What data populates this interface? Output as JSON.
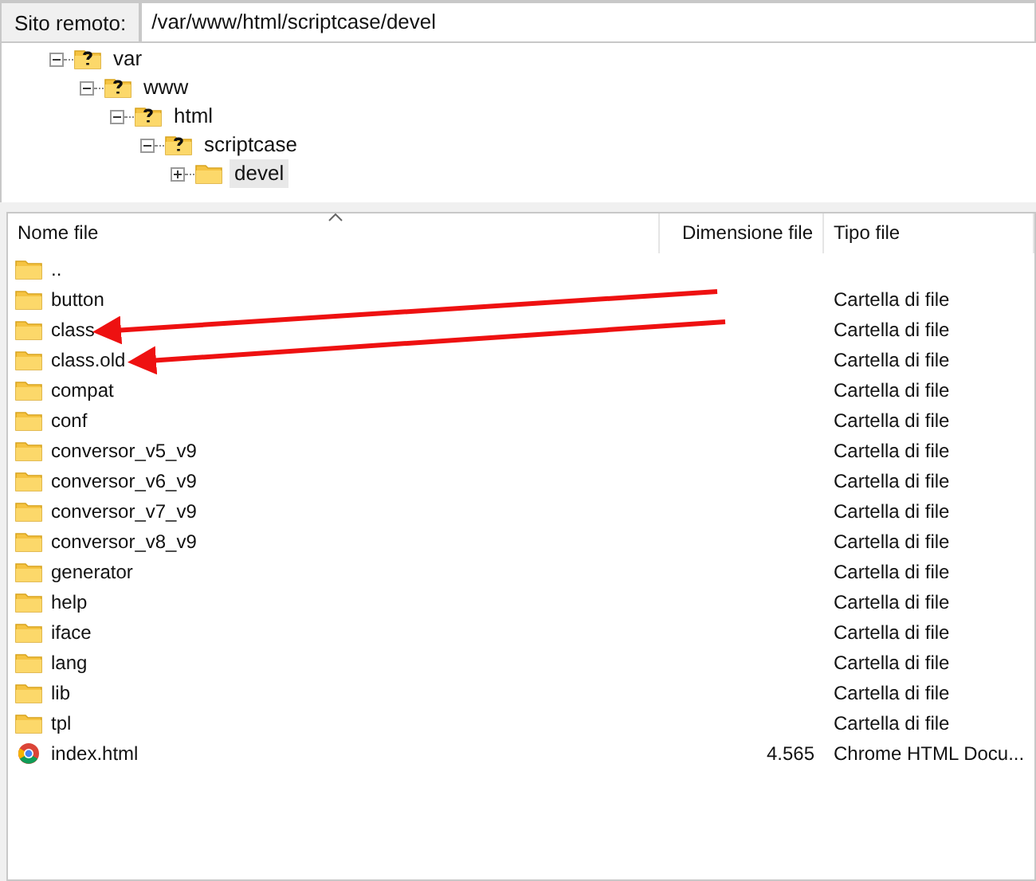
{
  "remote_site": {
    "label": "Sito remoto:",
    "value": "/var/www/html/scriptcase/devel"
  },
  "tree": [
    {
      "label": "var",
      "kind": "unknown",
      "expanded": true,
      "selected": false,
      "children": [
        {
          "label": "www",
          "kind": "unknown",
          "expanded": true,
          "selected": false,
          "children": [
            {
              "label": "html",
              "kind": "unknown",
              "expanded": true,
              "selected": false,
              "children": [
                {
                  "label": "scriptcase",
                  "kind": "unknown",
                  "expanded": true,
                  "selected": false,
                  "children": [
                    {
                      "label": "devel",
                      "kind": "folder",
                      "expanded": false,
                      "selected": true
                    }
                  ]
                }
              ]
            }
          ]
        }
      ]
    }
  ],
  "table": {
    "columns": [
      {
        "label": "Nome file",
        "sorted": true
      },
      {
        "label": "Dimensione file",
        "sorted": false
      },
      {
        "label": "Tipo file",
        "sorted": false
      }
    ],
    "rows": [
      {
        "name": "..",
        "kind": "folder"
      },
      {
        "name": "button",
        "type": "Cartella di file",
        "kind": "folder"
      },
      {
        "name": "class",
        "type": "Cartella di file",
        "kind": "folder"
      },
      {
        "name": "class.old",
        "type": "Cartella di file",
        "kind": "folder"
      },
      {
        "name": "compat",
        "type": "Cartella di file",
        "kind": "folder"
      },
      {
        "name": "conf",
        "type": "Cartella di file",
        "kind": "folder"
      },
      {
        "name": "conversor_v5_v9",
        "type": "Cartella di file",
        "kind": "folder"
      },
      {
        "name": "conversor_v6_v9",
        "type": "Cartella di file",
        "kind": "folder"
      },
      {
        "name": "conversor_v7_v9",
        "type": "Cartella di file",
        "kind": "folder"
      },
      {
        "name": "conversor_v8_v9",
        "type": "Cartella di file",
        "kind": "folder"
      },
      {
        "name": "generator",
        "type": "Cartella di file",
        "kind": "folder"
      },
      {
        "name": "help",
        "type": "Cartella di file",
        "kind": "folder"
      },
      {
        "name": "iface",
        "type": "Cartella di file",
        "kind": "folder"
      },
      {
        "name": "lang",
        "type": "Cartella di file",
        "kind": "folder"
      },
      {
        "name": "lib",
        "type": "Cartella di file",
        "kind": "folder"
      },
      {
        "name": "tpl",
        "type": "Cartella di file",
        "kind": "folder"
      },
      {
        "name": "index.html",
        "size": "4.565",
        "type": "Chrome HTML Docu...",
        "kind": "chrome"
      }
    ]
  }
}
